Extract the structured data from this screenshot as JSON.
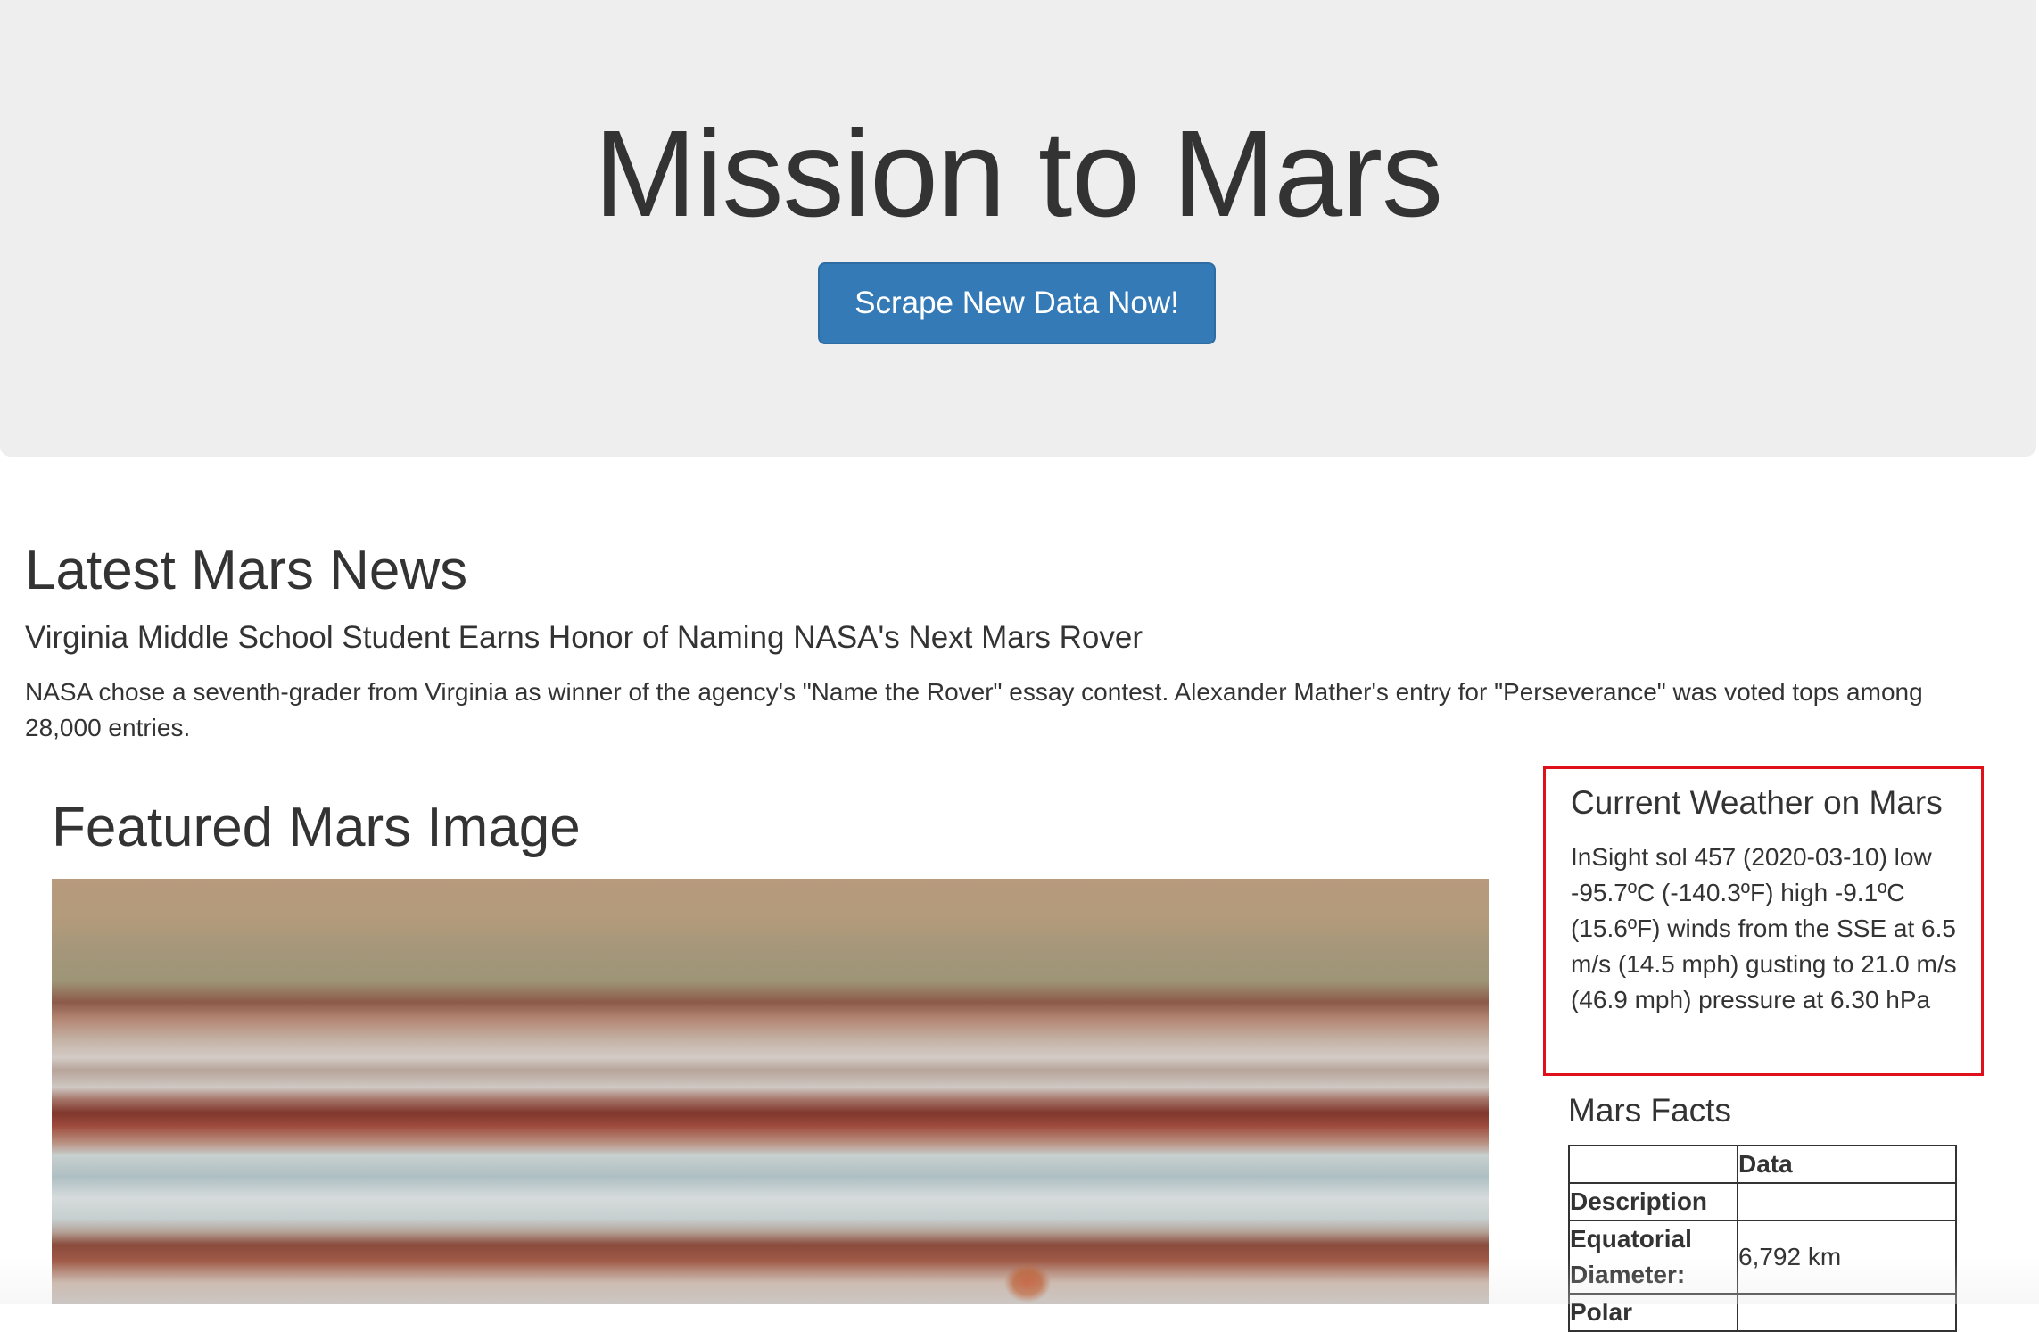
{
  "header": {
    "title": "Mission to Mars",
    "scrape_button_label": "Scrape New Data Now!"
  },
  "news": {
    "heading": "Latest Mars News",
    "title": "Virginia Middle School Student Earns Honor of Naming NASA's Next Mars Rover",
    "paragraph": "NASA chose a seventh-grader from Virginia as winner of the agency's \"Name the Rover\" essay contest. Alexander Mather's entry for \"Perseverance\" was voted tops among 28,000 entries."
  },
  "featured": {
    "heading": "Featured Mars Image"
  },
  "weather": {
    "heading": "Current Weather on Mars",
    "text": "InSight sol 457 (2020-03-10) low -95.7ºC (-140.3ºF) high -9.1ºC (15.6ºF) winds from the SSE at 6.5 m/s (14.5 mph) gusting to 21.0 m/s (46.9 mph) pressure at 6.30 hPa",
    "highlight_color": "#e0101b"
  },
  "facts": {
    "heading": "Mars Facts",
    "table": {
      "header": [
        "",
        "Data"
      ],
      "rows": [
        {
          "label": "Description",
          "value": ""
        },
        {
          "label": "Equatorial Diameter:",
          "value": "6,792 km"
        },
        {
          "label": "Polar",
          "value": ""
        }
      ]
    }
  },
  "colors": {
    "jumbotron_bg": "#eeeeee",
    "button_bg": "#337ab7",
    "text": "#333333"
  }
}
